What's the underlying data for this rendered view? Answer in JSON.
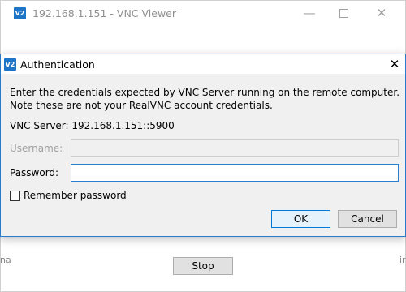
{
  "background_window": {
    "title": "192.168.1.151 - VNC Viewer",
    "logo_text": "V2",
    "minimize_glyph": "—",
    "close_glyph": "✕",
    "stop_label": "Stop",
    "left_edge_text": "na",
    "right_edge_text": "ir"
  },
  "dialog": {
    "title": "Authentication",
    "logo_text": "V2",
    "close_glyph": "✕",
    "description_line1": "Enter the credentials expected by VNC Server running on the remote computer.",
    "description_line2": "Note these are not your RealVNC account credentials.",
    "server_label": "VNC Server:",
    "server_value": "192.168.1.151::5900",
    "username_label": "Username:",
    "username_value": "",
    "password_label": "Password:",
    "password_value": "",
    "remember_label": "Remember password",
    "remember_checked": false,
    "ok_label": "OK",
    "cancel_label": "Cancel"
  },
  "colors": {
    "brand": "#1e74c6",
    "focus_border": "#2c7cd0",
    "dialog_bg": "#f0f0f0"
  }
}
